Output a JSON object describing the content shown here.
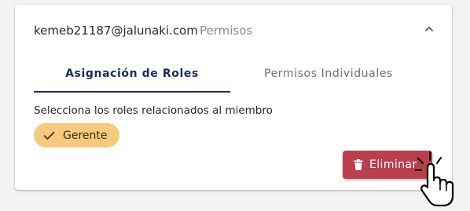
{
  "header": {
    "email": "kemeb21187@jalunaki.com",
    "section": "Permisos"
  },
  "tabs": [
    {
      "label": "Asignación de Roles",
      "active": true
    },
    {
      "label": "Permisos Individuales",
      "active": false
    }
  ],
  "roles": {
    "description": "Selecciona los roles relacionados al miembro",
    "chips": [
      {
        "label": "Gerente",
        "selected": true
      }
    ]
  },
  "actions": {
    "delete_label": "Eliminar"
  },
  "colors": {
    "primary": "#1b2a5b",
    "chip": "#f6c97d",
    "danger": "#b83f4b"
  },
  "icons": {
    "collapse": "chevron-up-icon",
    "check": "check-icon",
    "delete": "trash-icon",
    "cursor": "hand-pointer-click-icon"
  }
}
